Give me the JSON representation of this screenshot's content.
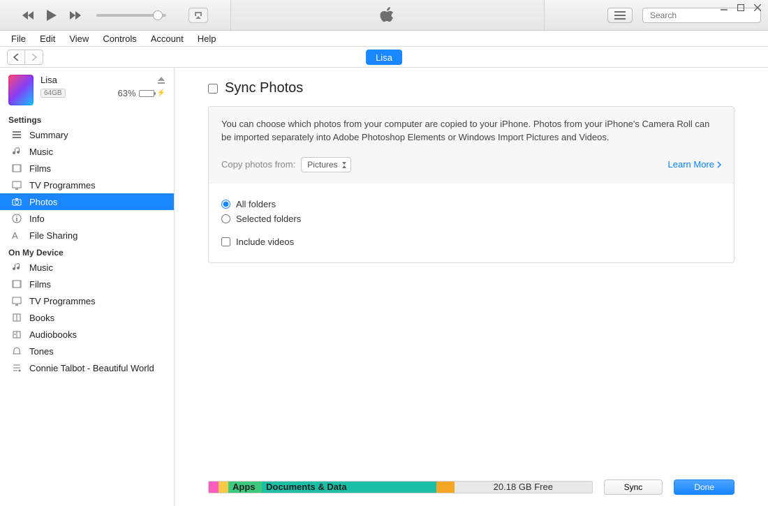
{
  "search": {
    "placeholder": "Search"
  },
  "menu": [
    "File",
    "Edit",
    "View",
    "Controls",
    "Account",
    "Help"
  ],
  "device_tab": "Lisa",
  "device": {
    "name": "Lisa",
    "capacity_badge": "64GB",
    "battery_pct": "63%",
    "battery_fill_pct": 63
  },
  "sidebar": {
    "settings_header": "Settings",
    "settings_items": [
      {
        "id": "summary",
        "label": "Summary"
      },
      {
        "id": "music",
        "label": "Music"
      },
      {
        "id": "films",
        "label": "Films"
      },
      {
        "id": "tv",
        "label": "TV Programmes"
      },
      {
        "id": "photos",
        "label": "Photos"
      },
      {
        "id": "info",
        "label": "Info"
      },
      {
        "id": "fileshare",
        "label": "File Sharing"
      }
    ],
    "device_header": "On My Device",
    "device_items": [
      {
        "id": "d-music",
        "label": "Music"
      },
      {
        "id": "d-films",
        "label": "Films"
      },
      {
        "id": "d-tv",
        "label": "TV Programmes"
      },
      {
        "id": "d-books",
        "label": "Books"
      },
      {
        "id": "d-audio",
        "label": "Audiobooks"
      },
      {
        "id": "d-tones",
        "label": "Tones"
      },
      {
        "id": "d-song",
        "label": "Connie Talbot - Beautiful World"
      }
    ]
  },
  "sync": {
    "title": "Sync Photos",
    "desc": "You can choose which photos from your computer are copied to your iPhone. Photos from your iPhone's Camera Roll can be imported separately into Adobe Photoshop Elements or Windows Import Pictures and Videos.",
    "copy_label": "Copy photos from:",
    "copy_source": "Pictures",
    "learn_more": "Learn More",
    "opt_all": "All folders",
    "opt_selected": "Selected folders",
    "opt_videos": "Include videos"
  },
  "storage": {
    "apps_label": "Apps",
    "docs_label": "Documents & Data",
    "free_label": "20.18 GB Free"
  },
  "footer": {
    "sync": "Sync",
    "done": "Done"
  },
  "volume_pct": 88
}
